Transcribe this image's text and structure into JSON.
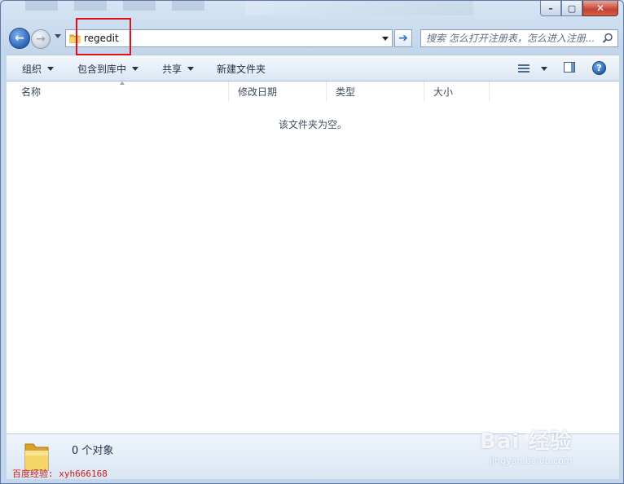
{
  "window": {
    "controls": {
      "minimize_glyph": "–",
      "maximize_glyph": "▢",
      "close_glyph": "✕"
    }
  },
  "nav": {
    "back_glyph": "←",
    "forward_glyph": "→",
    "address_value": "regedit",
    "go_glyph": "➔",
    "search_placeholder": "搜索 怎么打开注册表，怎么进入注册..."
  },
  "toolbar": {
    "organize_label": "组织",
    "include_library_label": "包含到库中",
    "share_label": "共享",
    "new_folder_label": "新建文件夹",
    "help_glyph": "?"
  },
  "columns": [
    {
      "label": "名称"
    },
    {
      "label": "修改日期"
    },
    {
      "label": "类型"
    },
    {
      "label": "大小"
    }
  ],
  "content": {
    "empty_message": "该文件夹为空。"
  },
  "details": {
    "item_count": "0 个对象"
  },
  "watermarks": {
    "bottom_left": "百度经验: xyh666168",
    "brand": "Bai 经验",
    "brand_sub": "jingyan.baidu.com"
  },
  "icons": {
    "address_folder": "folder-icon",
    "search": "search-icon",
    "views": "view-options-icon",
    "preview_pane": "preview-pane-icon",
    "help": "help-icon"
  },
  "colors": {
    "accent": "#2a64b8",
    "highlight_box": "#e0101a",
    "close_button": "#c5422f"
  }
}
